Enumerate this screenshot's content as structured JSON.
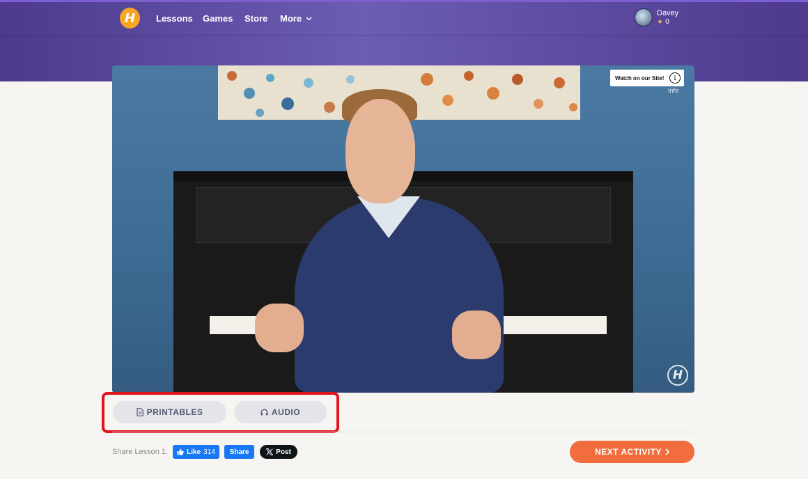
{
  "nav": {
    "logo_letter": "H",
    "links": [
      "Lessons",
      "Games",
      "Store",
      "More"
    ]
  },
  "user": {
    "name": "Davey",
    "points": "0"
  },
  "video": {
    "watch_on_site": "Watch on our Site!",
    "info_symbol": "i",
    "info_label": "Info",
    "watermark_letter": "H"
  },
  "resources": {
    "printables_label": "PRINTABLES",
    "audio_label": "AUDIO"
  },
  "share": {
    "label": "Share Lesson 1:",
    "like_label": "Like",
    "like_count": "314",
    "share_label": "Share",
    "post_label": "Post"
  },
  "next": {
    "label": "NEXT ACTIVITY"
  },
  "colors": {
    "brand_purple": "#5b4aa3",
    "accent_orange": "#f26d3d",
    "logo_yellow": "#f6a623",
    "facebook_blue": "#1877f2",
    "highlight_red": "#e0141d"
  }
}
